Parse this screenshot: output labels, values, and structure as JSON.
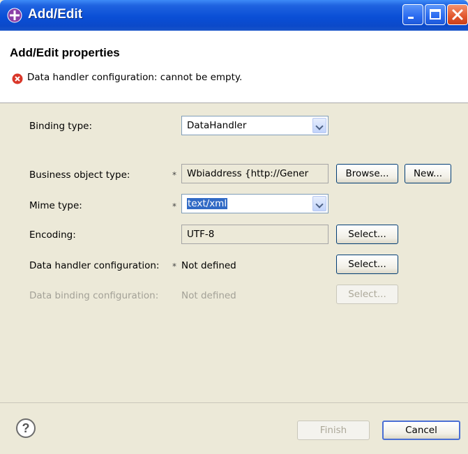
{
  "window": {
    "title": "Add/Edit"
  },
  "header": {
    "title": "Add/Edit properties",
    "error_message": "Data handler configuration: cannot be empty."
  },
  "form": {
    "binding_type": {
      "label": "Binding type:",
      "value": "DataHandler"
    },
    "business_object_type": {
      "label": "Business object type:",
      "required_marker": "*",
      "value": "Wbiaddress  {http://Gener",
      "browse_label": "Browse...",
      "new_label": "New..."
    },
    "mime_type": {
      "label": "Mime type:",
      "required_marker": "*",
      "value": "text/xml"
    },
    "encoding": {
      "label": "Encoding:",
      "value": "UTF-8",
      "select_label": "Select..."
    },
    "data_handler_configuration": {
      "label": "Data handler configuration:",
      "required_marker": "*",
      "value": "Not defined",
      "select_label": "Select..."
    },
    "data_binding_configuration": {
      "label": "Data binding configuration:",
      "value": "Not defined",
      "select_label": "Select..."
    }
  },
  "footer": {
    "finish_label": "Finish",
    "cancel_label": "Cancel"
  },
  "icons": {
    "app": "eclipse-plugin-icon",
    "error": "error-icon",
    "help": "help-icon",
    "minimize": "minimize-icon",
    "maximize": "maximize-icon",
    "close": "close-icon"
  },
  "colors": {
    "title_bar": "#0a4fd6",
    "selection": "#316ac5",
    "error": "#d9372a"
  }
}
